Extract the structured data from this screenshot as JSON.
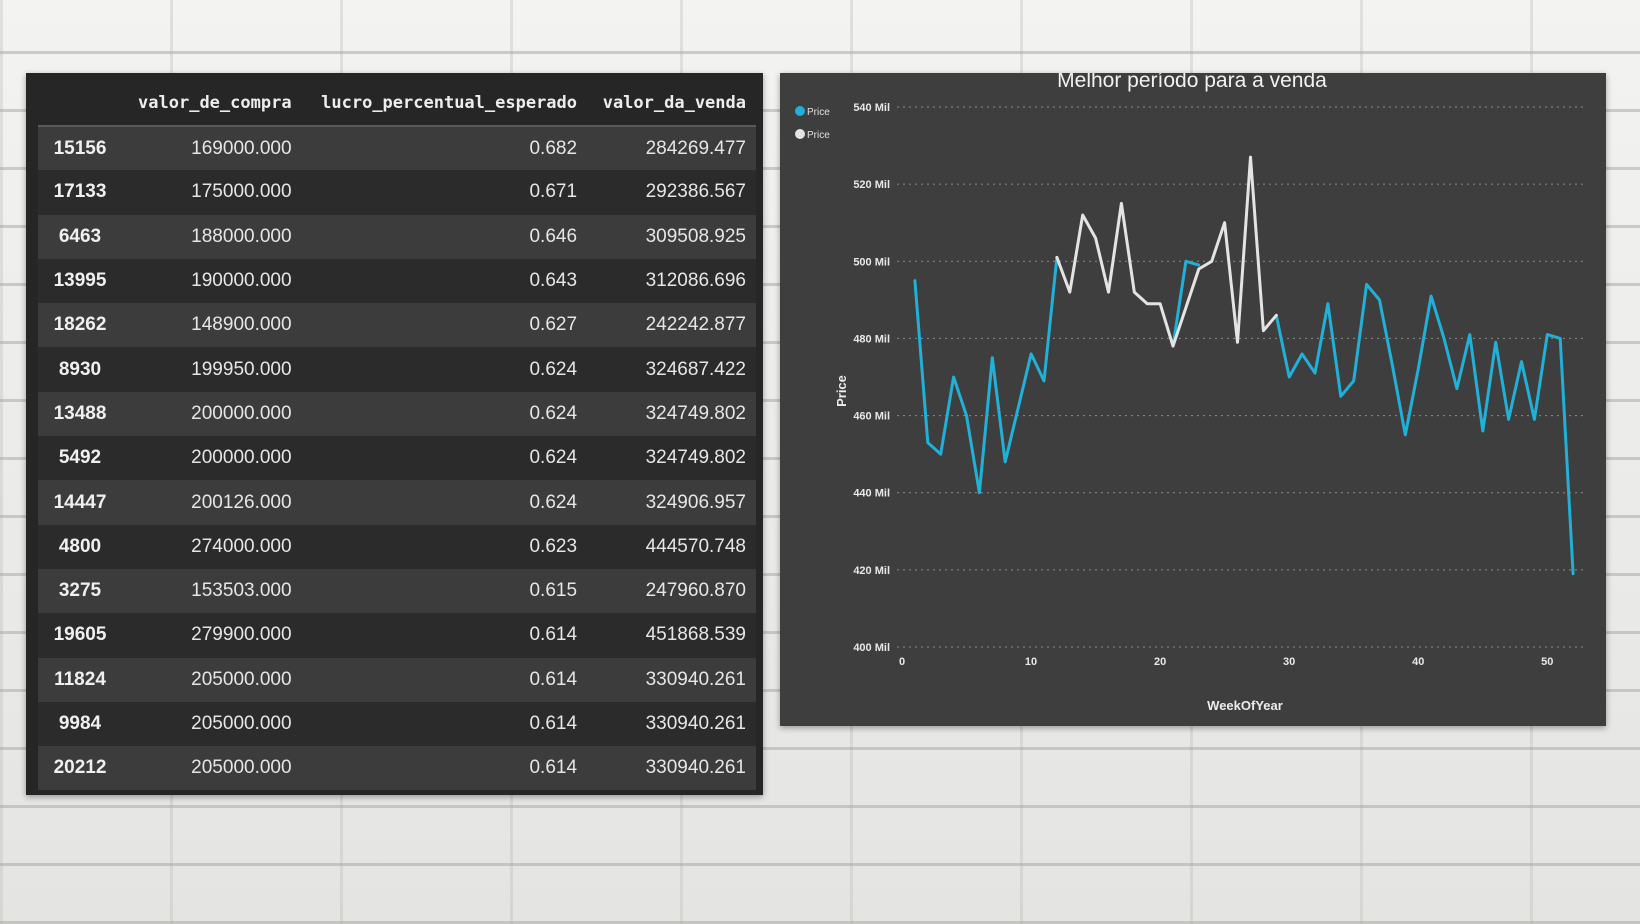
{
  "table": {
    "columns": [
      "",
      "valor_de_compra",
      "lucro_percentual_esperado",
      "valor_da_venda"
    ],
    "rows": [
      [
        "15156",
        "169000.000",
        "0.682",
        "284269.477"
      ],
      [
        "17133",
        "175000.000",
        "0.671",
        "292386.567"
      ],
      [
        "6463",
        "188000.000",
        "0.646",
        "309508.925"
      ],
      [
        "13995",
        "190000.000",
        "0.643",
        "312086.696"
      ],
      [
        "18262",
        "148900.000",
        "0.627",
        "242242.877"
      ],
      [
        "8930",
        "199950.000",
        "0.624",
        "324687.422"
      ],
      [
        "13488",
        "200000.000",
        "0.624",
        "324749.802"
      ],
      [
        "5492",
        "200000.000",
        "0.624",
        "324749.802"
      ],
      [
        "14447",
        "200126.000",
        "0.624",
        "324906.957"
      ],
      [
        "4800",
        "274000.000",
        "0.623",
        "444570.748"
      ],
      [
        "3275",
        "153503.000",
        "0.615",
        "247960.870"
      ],
      [
        "19605",
        "279900.000",
        "0.614",
        "451868.539"
      ],
      [
        "11824",
        "205000.000",
        "0.614",
        "330940.261"
      ],
      [
        "9984",
        "205000.000",
        "0.614",
        "330940.261"
      ],
      [
        "20212",
        "205000.000",
        "0.614",
        "330940.261"
      ]
    ]
  },
  "chart_data": {
    "type": "line",
    "title": "Melhor período para a venda",
    "xlabel": "WeekOfYear",
    "ylabel": "Price",
    "xlim": [
      0,
      53
    ],
    "ylim": [
      400,
      540
    ],
    "x_ticks": [
      0,
      10,
      20,
      30,
      40,
      50
    ],
    "y_ticks": [
      400,
      420,
      440,
      460,
      480,
      500,
      520,
      540
    ],
    "y_tick_labels": [
      "400 Mil",
      "420 Mil",
      "440 Mil",
      "460 Mil",
      "480 Mil",
      "500 Mil",
      "520 Mil",
      "540 Mil"
    ],
    "grid": true,
    "legend_position": "top-left",
    "series": [
      {
        "name": "Price",
        "color": "#21b0d8",
        "x": [
          1,
          2,
          3,
          4,
          5,
          6,
          7,
          8,
          9,
          10,
          11,
          12,
          13,
          14,
          15,
          16,
          17,
          18,
          19,
          20,
          21,
          22,
          23,
          24,
          25,
          26,
          27,
          28,
          29,
          30,
          31,
          32,
          33,
          34,
          35,
          36,
          37,
          38,
          39,
          40,
          41,
          42,
          43,
          44,
          45,
          46,
          47,
          48,
          49,
          50,
          51,
          52
        ],
        "values": [
          495,
          453,
          450,
          470,
          460,
          440,
          475,
          448,
          462,
          476,
          469,
          501,
          null,
          null,
          null,
          null,
          null,
          null,
          null,
          null,
          478,
          500,
          499,
          null,
          null,
          null,
          null,
          null,
          486,
          470,
          476,
          471,
          489,
          465,
          469,
          494,
          490,
          473,
          455,
          472,
          491,
          480,
          467,
          481,
          456,
          479,
          459,
          474,
          459,
          481,
          480,
          419
        ]
      },
      {
        "name": "Price",
        "color": "#e4e4e4",
        "x": [
          12,
          13,
          14,
          15,
          16,
          17,
          18,
          19,
          20,
          21,
          22,
          23,
          24,
          25,
          26,
          27,
          28,
          29
        ],
        "values": [
          501,
          492,
          512,
          506,
          492,
          515,
          492,
          489,
          489,
          478,
          488,
          498,
          500,
          510,
          479,
          527,
          482,
          486
        ]
      }
    ]
  }
}
